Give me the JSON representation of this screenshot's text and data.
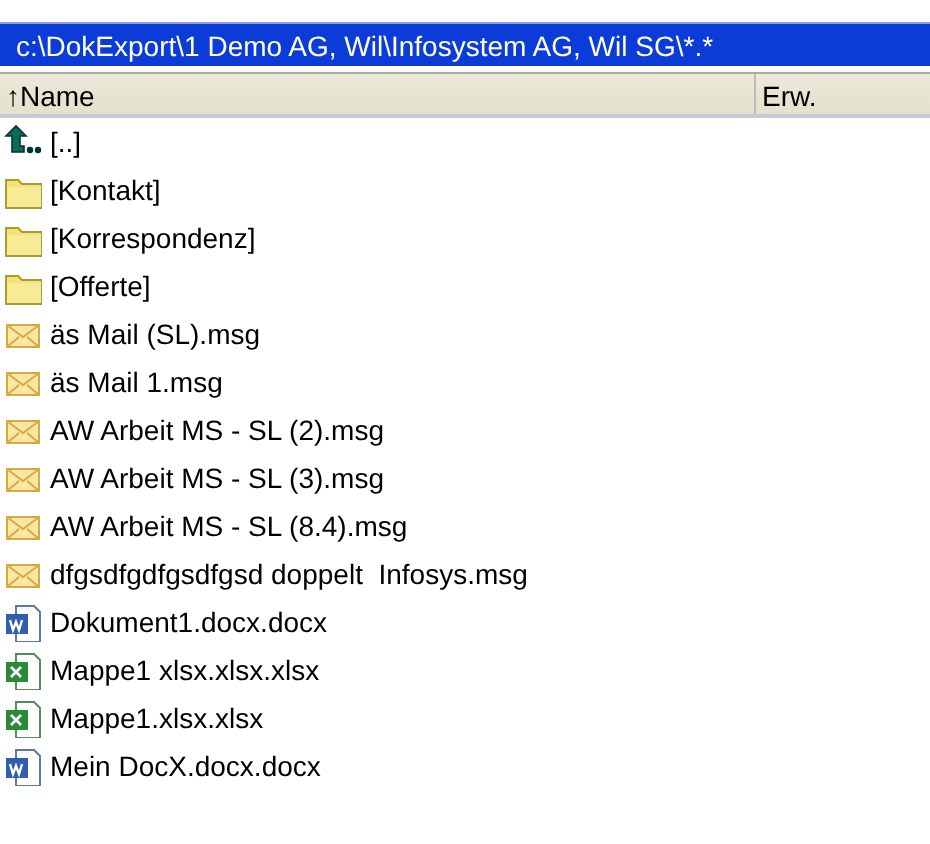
{
  "path_bar": {
    "text": "c:\\DokExport\\1 Demo AG, Wil\\Infosystem AG, Wil SG\\*.*"
  },
  "columns": [
    {
      "label": "↑Name"
    },
    {
      "label": "Erw."
    }
  ],
  "files": [
    {
      "kind": "up",
      "name": "[..]"
    },
    {
      "kind": "folder",
      "name": "[Kontakt]"
    },
    {
      "kind": "folder",
      "name": "[Korrespondenz]"
    },
    {
      "kind": "folder",
      "name": "[Offerte]"
    },
    {
      "kind": "mail",
      "name": "äs Mail (SL).msg"
    },
    {
      "kind": "mail",
      "name": "äs Mail 1.msg"
    },
    {
      "kind": "mail",
      "name": "AW Arbeit MS - SL (2).msg"
    },
    {
      "kind": "mail",
      "name": "AW Arbeit MS - SL (3).msg"
    },
    {
      "kind": "mail",
      "name": "AW Arbeit MS - SL (8.4).msg"
    },
    {
      "kind": "mail",
      "name": "dfgsdfgdfgsdfgsd doppelt  Infosys.msg"
    },
    {
      "kind": "word",
      "name": "Dokument1.docx.docx"
    },
    {
      "kind": "excel",
      "name": "Mappe1 xlsx.xlsx.xlsx"
    },
    {
      "kind": "excel",
      "name": "Mappe1.xlsx.xlsx"
    },
    {
      "kind": "word",
      "name": "Mein DocX.docx.docx"
    }
  ]
}
